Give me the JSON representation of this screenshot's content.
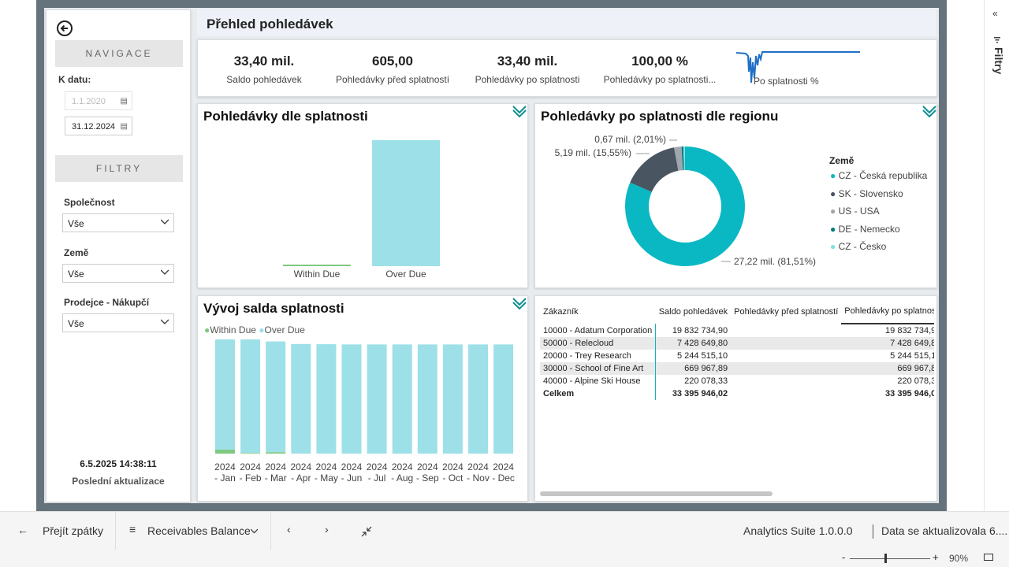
{
  "nav": {
    "header": "NAVIGACE",
    "date_label": "K datu:",
    "date_from": "1.1.2020",
    "date_to": "31.12.2024",
    "filters_header": "FILTRY",
    "company_label": "Společnost",
    "company_value": "Vše",
    "country_label": "Země",
    "country_value": "Vše",
    "seller_label": "Prodejce - Nákupčí",
    "seller_value": "Vše",
    "refresh_time": "6.5.2025 14:38:11",
    "refresh_label": "Poslední aktualizace"
  },
  "title": "Přehled pohledávek",
  "kpis": [
    {
      "value": "33,40 mil.",
      "label": "Saldo pohledávek"
    },
    {
      "value": "605,00",
      "label": "Pohledávky před splatností"
    },
    {
      "value": "33,40 mil.",
      "label": "Pohledávky po splatnosti"
    },
    {
      "value": "100,00 %",
      "label": "Pohledávky po splatnosti..."
    }
  ],
  "sparkline_label": "Po splatnosti %",
  "sparkline_color": "#1f6fc5",
  "colors": {
    "within": "#7fc97f",
    "over": "#9de0e8",
    "teal": "#0ab8c4",
    "dark": "#4a5562",
    "gray": "#a0a6ad",
    "darkteal": "#067b7f",
    "lightteal": "#7fe1e6"
  },
  "bar_chart": {
    "title": "Pohledávky dle splatnosti",
    "chart_data": {
      "type": "bar",
      "categories": [
        "Within Due",
        "Over Due"
      ],
      "values": [
        605,
        33395341
      ],
      "title": "Pohledávky dle splatnosti"
    }
  },
  "donut_chart": {
    "title": "Pohledávky po splatnosti dle regionu",
    "legend_title": "Země",
    "chart_data": {
      "type": "pie",
      "categories": [
        "CZ - Česká republika",
        "SK - Slovensko",
        "US - USA",
        "DE - Nemecko",
        "CZ - Česko"
      ],
      "values": [
        81.51,
        15.55,
        2.01,
        0.5,
        0.43
      ],
      "title": "Pohledávky po splatnosti dle regionu"
    },
    "labels": [
      {
        "text": "27,22 mil. (81,51%)"
      },
      {
        "text": "5,19 mil. (15,55%)"
      },
      {
        "text": "0,67 mil. (2,01%)"
      }
    ]
  },
  "stacked_chart": {
    "title": "Vývoj salda splatnosti",
    "legend": [
      "Within Due",
      "Over Due"
    ],
    "chart_data": {
      "type": "bar",
      "categories": [
        "2024 - Jan",
        "2024 - Feb",
        "2024 - Mar",
        "2024 - Apr",
        "2024 - May",
        "2024 - Jun",
        "2024 - Jul",
        "2024 - Aug",
        "2024 - Sep",
        "2024 - Oct",
        "2024 - Nov",
        "2024 - Dec"
      ],
      "series": [
        {
          "name": "Within Due",
          "values": [
            0.35,
            0.05,
            0.12,
            0.0,
            0.0,
            0.0,
            0.0,
            0.0,
            0.0,
            0.0,
            0.0,
            0.0
          ]
        },
        {
          "name": "Over Due",
          "values": [
            9.9,
            9.95,
            9.7,
            9.6,
            9.58,
            9.56,
            9.56,
            9.56,
            9.56,
            9.56,
            9.56,
            9.56
          ]
        }
      ],
      "ylim": [
        0,
        12
      ]
    },
    "tick_years": [
      "2024",
      "2024",
      "2024",
      "2024",
      "2024",
      "2024",
      "2024",
      "2024",
      "2024",
      "2024",
      "2024",
      "2024"
    ],
    "tick_months": [
      "- Jan",
      "- Feb",
      "- Mar",
      "- Apr",
      "- May",
      "- Jun",
      "- Jul",
      "- Aug",
      "- Sep",
      "- Oct",
      "- Nov",
      "- Dec"
    ]
  },
  "table": {
    "headers": [
      "Zákazník",
      "Saldo pohledávek",
      "Pohledávky před splatností",
      "Pohledávky po splatnos"
    ],
    "rows": [
      [
        "10000 - Adatum Corporation",
        "19 832 734,90",
        "",
        "19 832 734,9"
      ],
      [
        "50000 - Relecloud",
        "7 428 649,80",
        "",
        "7 428 649,8"
      ],
      [
        "20000 - Trey Research",
        "5 244 515,10",
        "",
        "5 244 515,1"
      ],
      [
        "30000 - School of Fine Art",
        "669 967,89",
        "",
        "669 967,8"
      ],
      [
        "40000 - Alpine Ski House",
        "220 078,33",
        "",
        "220 078,3"
      ]
    ],
    "total": [
      "Celkem",
      "33 395 946,02",
      "",
      "33 395 946,0"
    ]
  },
  "bottom": {
    "back": "Přejít zpátky",
    "report": "Receivables Balance",
    "suite": "Analytics Suite 1.0.0.0",
    "data_status": "Data se aktualizovala 6....",
    "zoom": "90%"
  },
  "right_rail": {
    "filters": "Filtry"
  }
}
